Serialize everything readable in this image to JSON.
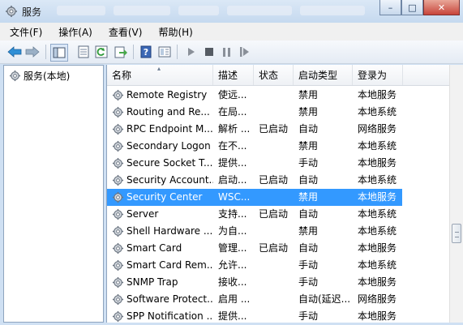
{
  "window": {
    "title": "服务"
  },
  "menu": [
    {
      "label": "文件(F)"
    },
    {
      "label": "操作(A)"
    },
    {
      "label": "查看(V)"
    },
    {
      "label": "帮助(H)"
    }
  ],
  "toolbar": {
    "icons": [
      "back-arrow-icon",
      "forward-arrow-icon",
      "show-hide-tree-icon",
      "properties-icon",
      "refresh-icon",
      "export-list-icon",
      "help-icon",
      "view-icon",
      "start-service-icon",
      "stop-service-icon",
      "pause-service-icon",
      "restart-service-icon"
    ]
  },
  "tree": {
    "root_label": "服务(本地)"
  },
  "columns": {
    "name": "名称",
    "description": "描述",
    "status": "状态",
    "startup": "启动类型",
    "logon": "登录为"
  },
  "services": [
    {
      "name": "Remote Registry",
      "description": "使远...",
      "status": "",
      "startup": "禁用",
      "logon": "本地服务"
    },
    {
      "name": "Routing and Re...",
      "description": "在局...",
      "status": "",
      "startup": "禁用",
      "logon": "本地系统"
    },
    {
      "name": "RPC Endpoint M...",
      "description": "解析 ...",
      "status": "已启动",
      "startup": "自动",
      "logon": "网络服务"
    },
    {
      "name": "Secondary Logon",
      "description": "在不...",
      "status": "",
      "startup": "禁用",
      "logon": "本地系统"
    },
    {
      "name": "Secure Socket T...",
      "description": "提供...",
      "status": "",
      "startup": "手动",
      "logon": "本地服务"
    },
    {
      "name": "Security Account...",
      "description": "启动...",
      "status": "已启动",
      "startup": "自动",
      "logon": "本地系统"
    },
    {
      "name": "Security Center",
      "description": "WSC...",
      "status": "",
      "startup": "禁用",
      "logon": "本地服务",
      "selected": true
    },
    {
      "name": "Server",
      "description": "支持...",
      "status": "已启动",
      "startup": "自动",
      "logon": "本地系统"
    },
    {
      "name": "Shell Hardware ...",
      "description": "为自...",
      "status": "",
      "startup": "禁用",
      "logon": "本地系统"
    },
    {
      "name": "Smart Card",
      "description": "管理...",
      "status": "已启动",
      "startup": "自动",
      "logon": "本地服务"
    },
    {
      "name": "Smart Card Rem...",
      "description": "允许...",
      "status": "",
      "startup": "手动",
      "logon": "本地系统"
    },
    {
      "name": "SNMP Trap",
      "description": "接收...",
      "status": "",
      "startup": "手动",
      "logon": "本地服务"
    },
    {
      "name": "Software Protect...",
      "description": "启用 ...",
      "status": "",
      "startup": "自动(延迟...",
      "logon": "网络服务"
    },
    {
      "name": "SPP Notification ...",
      "description": "提供...",
      "status": "",
      "startup": "手动",
      "logon": "本地服务"
    }
  ],
  "colors": {
    "selection": "#3399ff",
    "border": "#8ea4be"
  }
}
